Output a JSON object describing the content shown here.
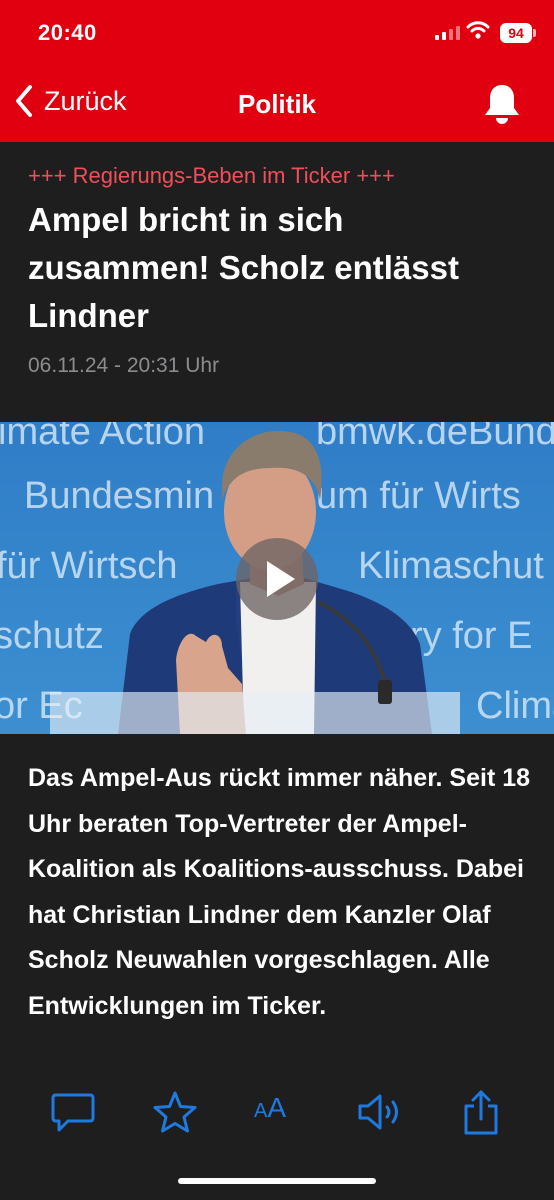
{
  "status_bar": {
    "time": "20:40",
    "battery": "94"
  },
  "nav": {
    "back_label": "Zurück",
    "title": "Politik"
  },
  "article": {
    "kicker": "+++ Regierungs-Beben im Ticker +++",
    "headline": "Ampel bricht in sich zusammen! Scholz entlässt Lindner",
    "date": "06.11.24 - 20:31 Uhr",
    "video_backdrop_texts": [
      "imate Action",
      "bmwk.de",
      "Bund",
      "Bundesmin",
      "um für Wirts",
      "für Wirtsch",
      "Klimaschut",
      "schutz",
      "ry for E",
      "or Ec",
      "Clima"
    ],
    "lede": "Das Ampel-Aus rückt immer näher. Seit 18 Uhr beraten Top-Vertreter der Ampel-Koalition als Koalitions-ausschuss. Dabei hat Christian Lindner dem Kanzler Olaf Scholz Neuwahlen vorgeschlagen. Alle Entwicklungen im Ticker."
  },
  "toolbar": {
    "font_size_label": "A"
  },
  "colors": {
    "brand_red": "#e0000f",
    "kicker_red": "#ee4f5a",
    "toolbar_blue": "#1f7ae0",
    "background": "#1e1e1f",
    "backdrop_blue": "#3f88cb"
  },
  "icons": [
    "cellular-signal-icon",
    "wifi-icon",
    "battery-icon",
    "chevron-left-icon",
    "bell-icon",
    "play-icon",
    "comment-icon",
    "star-icon",
    "text-size-icon",
    "speaker-icon",
    "share-icon"
  ]
}
